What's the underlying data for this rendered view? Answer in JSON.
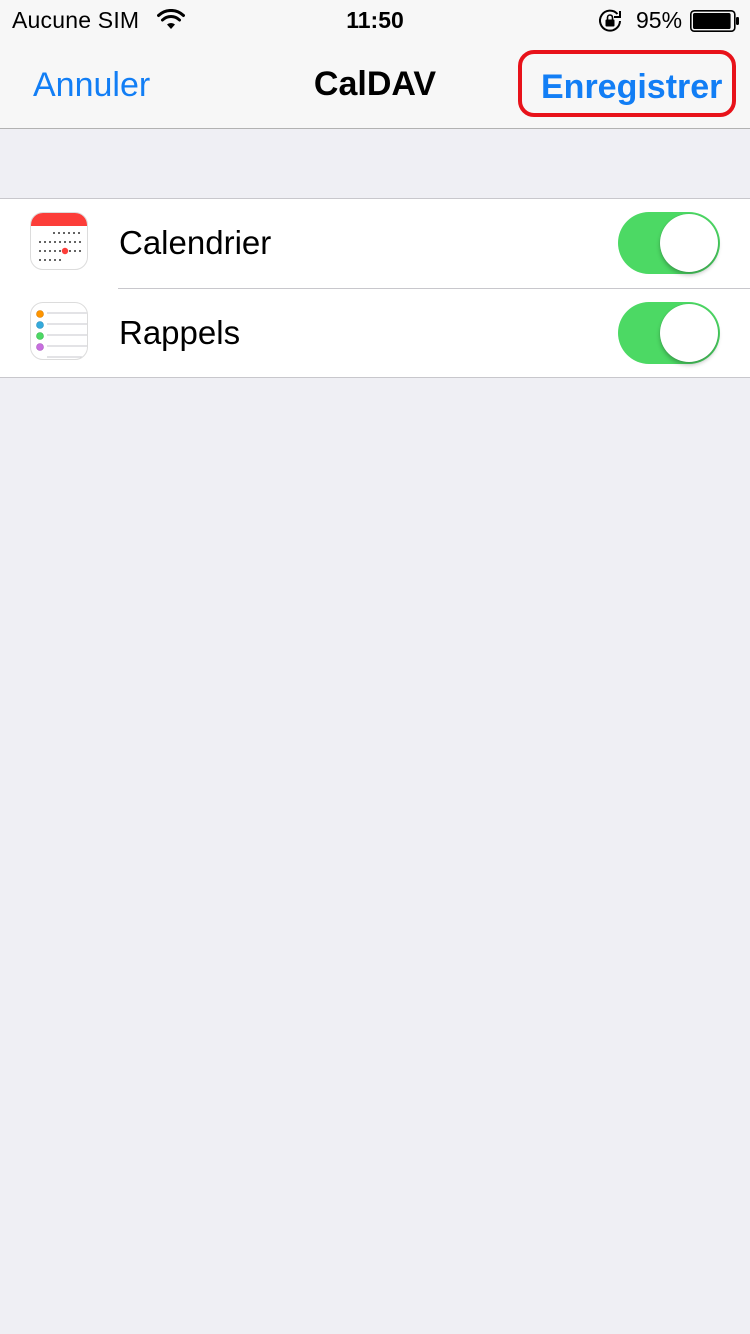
{
  "status_bar": {
    "carrier": "Aucune SIM",
    "time": "11:50",
    "battery_percent": "95%",
    "battery_level": 0.95
  },
  "nav": {
    "cancel_label": "Annuler",
    "title": "CalDAV",
    "save_label": "Enregistrer",
    "highlight_color": "#e8121a",
    "tint_color": "#127ef5"
  },
  "services": [
    {
      "label": "Calendrier",
      "icon": "calendar-icon",
      "enabled": true
    },
    {
      "label": "Rappels",
      "icon": "reminders-icon",
      "enabled": true
    }
  ],
  "colors": {
    "toggle_on": "#4cd964",
    "background": "#efeff4"
  }
}
